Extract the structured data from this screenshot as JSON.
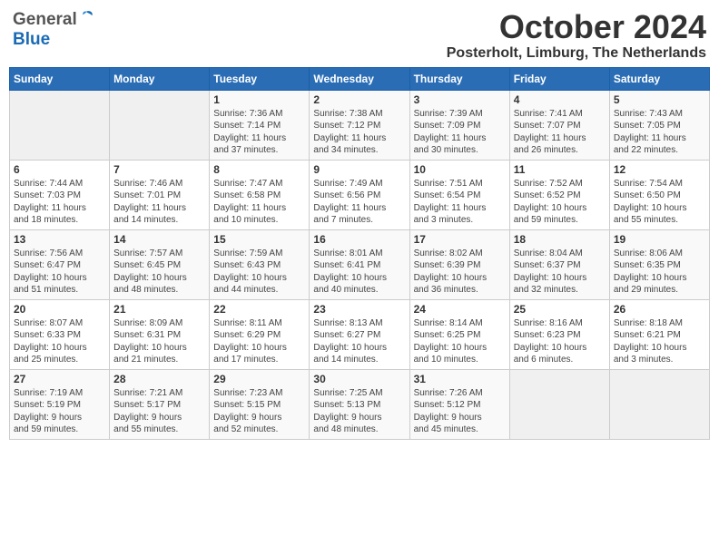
{
  "header": {
    "logo_general": "General",
    "logo_blue": "Blue",
    "month": "October 2024",
    "location": "Posterholt, Limburg, The Netherlands"
  },
  "weekdays": [
    "Sunday",
    "Monday",
    "Tuesday",
    "Wednesday",
    "Thursday",
    "Friday",
    "Saturday"
  ],
  "weeks": [
    [
      {
        "day": "",
        "info": ""
      },
      {
        "day": "",
        "info": ""
      },
      {
        "day": "1",
        "info": "Sunrise: 7:36 AM\nSunset: 7:14 PM\nDaylight: 11 hours\nand 37 minutes."
      },
      {
        "day": "2",
        "info": "Sunrise: 7:38 AM\nSunset: 7:12 PM\nDaylight: 11 hours\nand 34 minutes."
      },
      {
        "day": "3",
        "info": "Sunrise: 7:39 AM\nSunset: 7:09 PM\nDaylight: 11 hours\nand 30 minutes."
      },
      {
        "day": "4",
        "info": "Sunrise: 7:41 AM\nSunset: 7:07 PM\nDaylight: 11 hours\nand 26 minutes."
      },
      {
        "day": "5",
        "info": "Sunrise: 7:43 AM\nSunset: 7:05 PM\nDaylight: 11 hours\nand 22 minutes."
      }
    ],
    [
      {
        "day": "6",
        "info": "Sunrise: 7:44 AM\nSunset: 7:03 PM\nDaylight: 11 hours\nand 18 minutes."
      },
      {
        "day": "7",
        "info": "Sunrise: 7:46 AM\nSunset: 7:01 PM\nDaylight: 11 hours\nand 14 minutes."
      },
      {
        "day": "8",
        "info": "Sunrise: 7:47 AM\nSunset: 6:58 PM\nDaylight: 11 hours\nand 10 minutes."
      },
      {
        "day": "9",
        "info": "Sunrise: 7:49 AM\nSunset: 6:56 PM\nDaylight: 11 hours\nand 7 minutes."
      },
      {
        "day": "10",
        "info": "Sunrise: 7:51 AM\nSunset: 6:54 PM\nDaylight: 11 hours\nand 3 minutes."
      },
      {
        "day": "11",
        "info": "Sunrise: 7:52 AM\nSunset: 6:52 PM\nDaylight: 10 hours\nand 59 minutes."
      },
      {
        "day": "12",
        "info": "Sunrise: 7:54 AM\nSunset: 6:50 PM\nDaylight: 10 hours\nand 55 minutes."
      }
    ],
    [
      {
        "day": "13",
        "info": "Sunrise: 7:56 AM\nSunset: 6:47 PM\nDaylight: 10 hours\nand 51 minutes."
      },
      {
        "day": "14",
        "info": "Sunrise: 7:57 AM\nSunset: 6:45 PM\nDaylight: 10 hours\nand 48 minutes."
      },
      {
        "day": "15",
        "info": "Sunrise: 7:59 AM\nSunset: 6:43 PM\nDaylight: 10 hours\nand 44 minutes."
      },
      {
        "day": "16",
        "info": "Sunrise: 8:01 AM\nSunset: 6:41 PM\nDaylight: 10 hours\nand 40 minutes."
      },
      {
        "day": "17",
        "info": "Sunrise: 8:02 AM\nSunset: 6:39 PM\nDaylight: 10 hours\nand 36 minutes."
      },
      {
        "day": "18",
        "info": "Sunrise: 8:04 AM\nSunset: 6:37 PM\nDaylight: 10 hours\nand 32 minutes."
      },
      {
        "day": "19",
        "info": "Sunrise: 8:06 AM\nSunset: 6:35 PM\nDaylight: 10 hours\nand 29 minutes."
      }
    ],
    [
      {
        "day": "20",
        "info": "Sunrise: 8:07 AM\nSunset: 6:33 PM\nDaylight: 10 hours\nand 25 minutes."
      },
      {
        "day": "21",
        "info": "Sunrise: 8:09 AM\nSunset: 6:31 PM\nDaylight: 10 hours\nand 21 minutes."
      },
      {
        "day": "22",
        "info": "Sunrise: 8:11 AM\nSunset: 6:29 PM\nDaylight: 10 hours\nand 17 minutes."
      },
      {
        "day": "23",
        "info": "Sunrise: 8:13 AM\nSunset: 6:27 PM\nDaylight: 10 hours\nand 14 minutes."
      },
      {
        "day": "24",
        "info": "Sunrise: 8:14 AM\nSunset: 6:25 PM\nDaylight: 10 hours\nand 10 minutes."
      },
      {
        "day": "25",
        "info": "Sunrise: 8:16 AM\nSunset: 6:23 PM\nDaylight: 10 hours\nand 6 minutes."
      },
      {
        "day": "26",
        "info": "Sunrise: 8:18 AM\nSunset: 6:21 PM\nDaylight: 10 hours\nand 3 minutes."
      }
    ],
    [
      {
        "day": "27",
        "info": "Sunrise: 7:19 AM\nSunset: 5:19 PM\nDaylight: 9 hours\nand 59 minutes."
      },
      {
        "day": "28",
        "info": "Sunrise: 7:21 AM\nSunset: 5:17 PM\nDaylight: 9 hours\nand 55 minutes."
      },
      {
        "day": "29",
        "info": "Sunrise: 7:23 AM\nSunset: 5:15 PM\nDaylight: 9 hours\nand 52 minutes."
      },
      {
        "day": "30",
        "info": "Sunrise: 7:25 AM\nSunset: 5:13 PM\nDaylight: 9 hours\nand 48 minutes."
      },
      {
        "day": "31",
        "info": "Sunrise: 7:26 AM\nSunset: 5:12 PM\nDaylight: 9 hours\nand 45 minutes."
      },
      {
        "day": "",
        "info": ""
      },
      {
        "day": "",
        "info": ""
      }
    ]
  ]
}
